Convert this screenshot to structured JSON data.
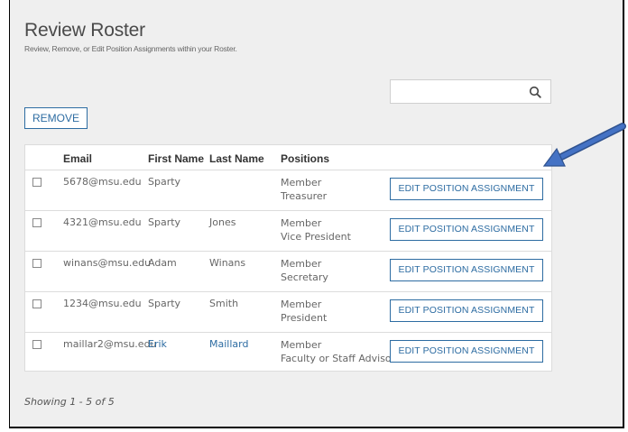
{
  "header": {
    "title": "Review Roster",
    "subtitle": "Review, Remove, or Edit Position Assignments within your Roster."
  },
  "search": {
    "value": "",
    "placeholder": "",
    "icon": "search-icon"
  },
  "toolbar": {
    "remove_label": "REMOVE"
  },
  "table": {
    "columns": [
      "Email",
      "First Name",
      "Last Name",
      "Positions"
    ],
    "rows": [
      {
        "email": "5678@msu.edu",
        "first": "Sparty",
        "last": "",
        "pos1": "Member",
        "pos2": "Treasurer",
        "action": "EDIT POSITION ASSIGNMENT"
      },
      {
        "email": "4321@msu.edu",
        "first": "Sparty",
        "last": "Jones",
        "pos1": "Member",
        "pos2": "Vice President",
        "action": "EDIT POSITION ASSIGNMENT"
      },
      {
        "email": "winans@msu.edu",
        "first": "Adam",
        "last": "Winans",
        "pos1": "Member",
        "pos2": "Secretary",
        "action": "EDIT POSITION ASSIGNMENT"
      },
      {
        "email": "1234@msu.edu",
        "first": "Sparty",
        "last": "Smith",
        "pos1": "Member",
        "pos2": "President",
        "action": "EDIT POSITION ASSIGNMENT"
      },
      {
        "email": "maillar2@msu.edu",
        "first": "Erik",
        "last": "Maillard",
        "pos1": "Member",
        "pos2": "Faculty or Staff Advisor",
        "action": "EDIT POSITION ASSIGNMENT"
      }
    ]
  },
  "footer": {
    "status": "Showing 1 - 5 of 5"
  },
  "colors": {
    "accent": "#2d6ca2",
    "background": "#efefef",
    "annotation_arrow": "#4472c4"
  }
}
